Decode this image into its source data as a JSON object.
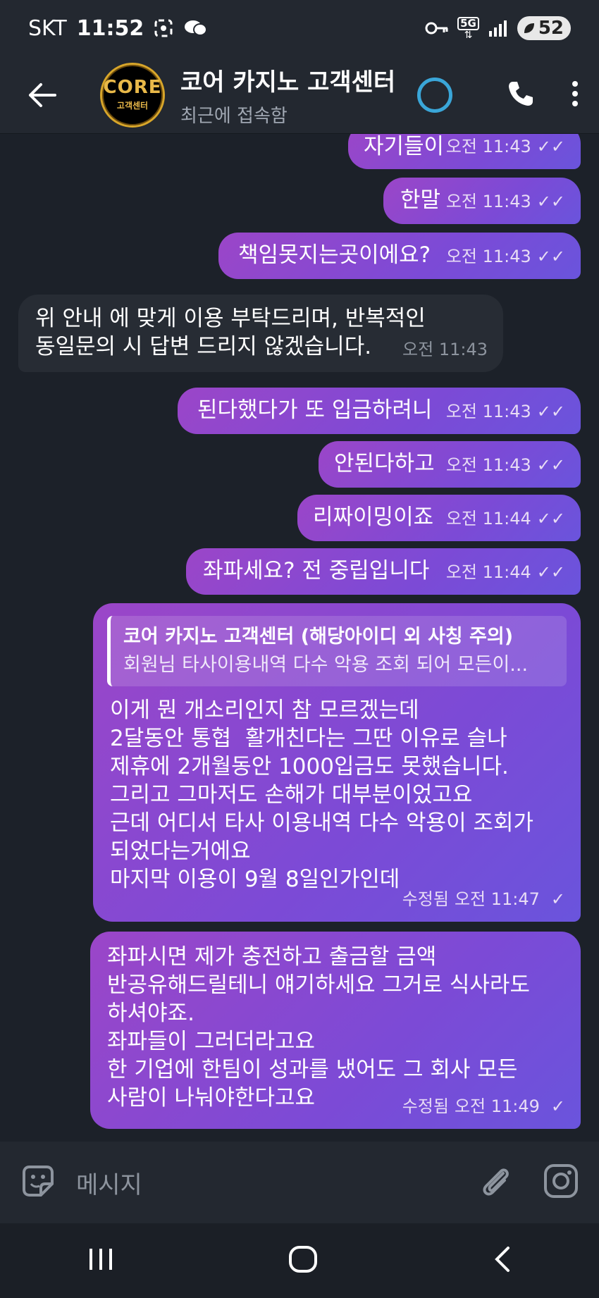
{
  "status_bar": {
    "carrier": "SKT",
    "time": "11:52",
    "network": "5G",
    "battery": "52"
  },
  "header": {
    "title": "코어 카지노 고객센터",
    "subtitle": "최근에 접속함",
    "avatar_text": "CORE",
    "avatar_sub": "고객센터"
  },
  "messages": [
    {
      "dir": "out",
      "text": "자기들이",
      "time": "오전 11:43",
      "status": "read"
    },
    {
      "dir": "out",
      "text": "한말",
      "time": "오전 11:43",
      "status": "read"
    },
    {
      "dir": "out",
      "text": "책임못지는곳이에요?",
      "time": "오전 11:43",
      "status": "read"
    },
    {
      "dir": "in",
      "text": "위 안내 에 맞게 이용 부탁드리며, 반복적인\n동일문의 시 답변 드리지 않겠습니다.",
      "time": "오전 11:43"
    },
    {
      "dir": "out",
      "text": "된다했다가 또 입금하려니",
      "time": "오전 11:43",
      "status": "read"
    },
    {
      "dir": "out",
      "text": "안된다하고",
      "time": "오전 11:43",
      "status": "read"
    },
    {
      "dir": "out",
      "text": "리짜이밍이죠",
      "time": "오전 11:44",
      "status": "read"
    },
    {
      "dir": "out",
      "text": "좌파세요? 전 중립입니다",
      "time": "오전 11:44",
      "status": "read"
    },
    {
      "dir": "out",
      "quote_title": "코어 카지노 고객센터 (해당아이디 외 사칭 주의)",
      "quote_text": "회원님 타사이용내역 다수 악용 조회 되어 모든이...",
      "text": "이게 뭔 개소리인지 참 모르겠는데\n2달동안 통협  활개친다는 그딴 이유로 슬나\n제휴에 2개월동안 1000입금도 못했습니다.\n그리고 그마저도 손해가 대부분이었고요\n근데 어디서 타사 이용내역 다수 악용이 조회가\n되었다는거에요\n마지막 이용이 9월 8일인가인데",
      "edited": "수정됨",
      "time": "오전 11:47",
      "status": "sent"
    },
    {
      "dir": "out",
      "text": "좌파시면 제가 충전하고 출금할 금액\n반공유해드릴테니 얘기하세요 그거로 식사라도\n하셔야죠.\n좌파들이 그러더라고요\n한 기업에 한팀이 성과를 냈어도 그 회사 모든\n사람이 나눠야한다고요",
      "edited": "수정됨",
      "time": "오전 11:49",
      "status": "sent"
    }
  ],
  "composer": {
    "placeholder": "메시지"
  },
  "colors": {
    "outgoing_bubble_start": "#9b46c8",
    "outgoing_bubble_end": "#6a54dc",
    "incoming_bubble": "#272c34",
    "background": "#1c2129"
  }
}
